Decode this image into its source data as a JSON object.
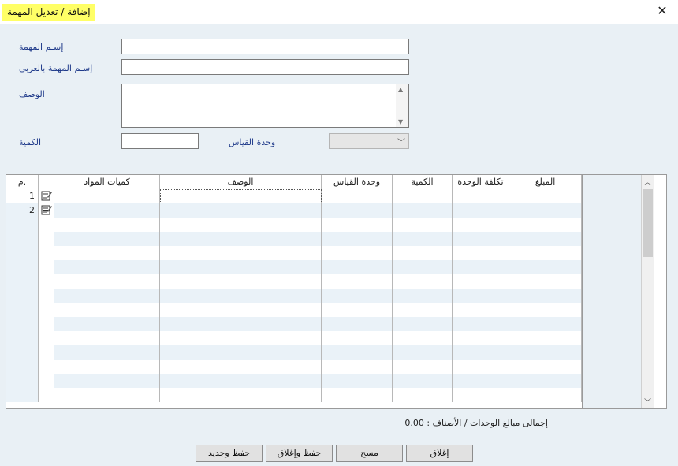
{
  "window": {
    "title": "إضافة / تعديل المهمة",
    "close_glyph": "✕"
  },
  "form": {
    "task_name_label": "إسـم المهمة",
    "task_name_ar_label": "إسـم المهمة بالعربي",
    "description_label": "الوصف",
    "quantity_label": "الكمية",
    "unit_label": "وحدة القياس",
    "task_name_value": "",
    "task_name_ar_value": "",
    "description_value": "",
    "quantity_value": "",
    "unit_value": ""
  },
  "grid": {
    "columns": [
      "م.",
      "",
      "كميات المواد",
      "الوصف",
      "وحدة القياس",
      "الكمية",
      "تكلفة الوحدة",
      "المبلغ"
    ],
    "rows": [
      {
        "num": "1"
      },
      {
        "num": "2"
      }
    ]
  },
  "summary": {
    "label": "إجمالى مبالغ الوحدات / الأصناف :",
    "value": "0.00"
  },
  "buttons": {
    "save_new": "حفظ وجديد",
    "save_close": "حفظ وإغلاق",
    "clear": "مسح",
    "close": "إغلاق"
  },
  "colors": {
    "title_highlight": "#ffff66",
    "form_bg": "#e9f0f5",
    "label": "#1f3a8a",
    "row_alt": "#eaf2f8",
    "active_row_line": "#cc2222"
  }
}
